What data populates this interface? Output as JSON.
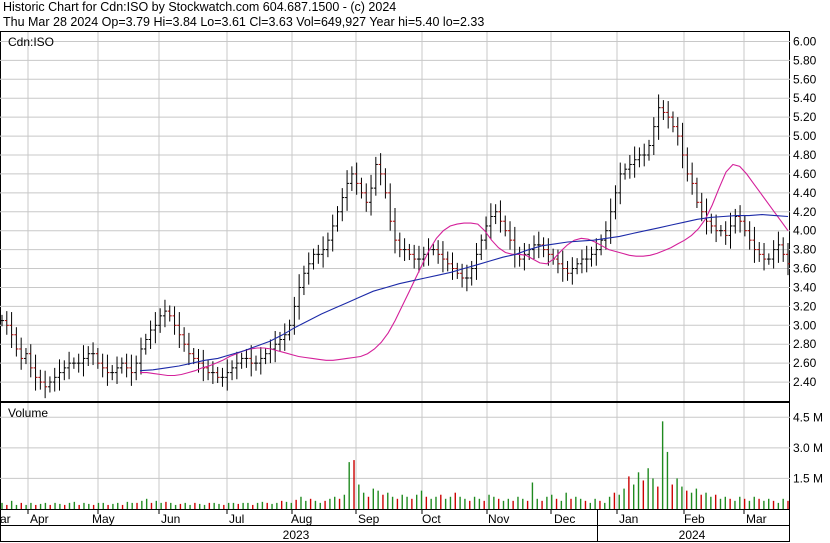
{
  "header": {
    "line1": "Historic Chart for Cdn:ISO by Stockwatch.com 604.687.1500 - (c) 2024",
    "line2": "Thu Mar 28 2024  Op=3.79  Hi=3.84  Lo=3.61  Cl=3.63  Vol=649,927  Year hi=5.40  lo=2.33"
  },
  "chart_data": [
    {
      "type": "ohlc",
      "title": "Cdn:ISO",
      "ylim": [
        2.2,
        6.1
      ],
      "yticks": [
        "2.40",
        "2.60",
        "2.80",
        "3.00",
        "3.20",
        "3.40",
        "3.60",
        "3.80",
        "4.00",
        "4.20",
        "4.40",
        "4.60",
        "4.80",
        "5.00",
        "5.20",
        "5.40",
        "5.60",
        "5.80",
        "6.00"
      ],
      "x_month_labels": [
        "ar",
        "Apr",
        "May",
        "Jun",
        "Jul",
        "Aug",
        "Sep",
        "Oct",
        "Nov",
        "Dec",
        "Jan",
        "Feb",
        "Mar"
      ],
      "x_year_labels": [
        "2023",
        "2024"
      ],
      "series": [
        {
          "name": "",
          "kind": "close",
          "values": [
            3.05,
            3.0,
            2.9,
            2.75,
            2.65,
            2.7,
            2.55,
            2.45,
            2.4,
            2.35,
            2.4,
            2.45,
            2.5,
            2.55,
            2.6,
            2.6,
            2.6,
            2.65,
            2.7,
            2.7,
            2.6,
            2.55,
            2.5,
            2.5,
            2.55,
            2.6,
            2.55,
            2.5,
            2.6,
            2.75,
            2.85,
            2.95,
            3.0,
            3.1,
            3.15,
            3.1,
            3.0,
            2.9,
            2.8,
            2.7,
            2.65,
            2.6,
            2.55,
            2.5,
            2.5,
            2.45,
            2.45,
            2.5,
            2.55,
            2.6,
            2.65,
            2.65,
            2.6,
            2.6,
            2.65,
            2.7,
            2.75,
            2.8,
            2.85,
            2.9,
            3.0,
            3.2,
            3.4,
            3.55,
            3.65,
            3.75,
            3.75,
            3.8,
            3.9,
            4.05,
            4.2,
            4.35,
            4.5,
            4.6,
            4.5,
            4.4,
            4.3,
            4.45,
            4.7,
            4.6,
            4.4,
            4.1,
            3.9,
            3.8,
            3.8,
            3.75,
            3.7,
            3.7,
            3.75,
            3.8,
            3.8,
            3.75,
            3.7,
            3.65,
            3.6,
            3.55,
            3.5,
            3.5,
            3.6,
            3.75,
            3.9,
            4.05,
            4.15,
            4.2,
            4.1,
            4.0,
            3.9,
            3.75,
            3.7,
            3.75,
            3.8,
            3.85,
            3.85,
            3.8,
            3.75,
            3.7,
            3.65,
            3.6,
            3.55,
            3.6,
            3.65,
            3.7,
            3.7,
            3.75,
            3.8,
            3.9,
            4.0,
            4.2,
            4.4,
            4.6,
            4.65,
            4.7,
            4.75,
            4.8,
            4.8,
            4.9,
            5.1,
            5.3,
            5.25,
            5.2,
            5.1,
            5.0,
            4.8,
            4.6,
            4.5,
            4.3,
            4.2,
            4.1,
            4.05,
            4.0,
            4.0,
            3.95,
            4.05,
            4.15,
            4.1,
            4.0,
            3.9,
            3.8,
            3.75,
            3.7,
            3.7,
            3.8,
            3.85,
            3.75,
            3.65
          ]
        },
        {
          "name": "",
          "kind": "ma-short",
          "color": "#d4209a",
          "values": [
            2.5,
            2.5,
            2.49,
            2.48,
            2.47,
            2.47,
            2.48,
            2.5,
            2.52,
            2.55,
            2.57,
            2.6,
            2.63,
            2.67,
            2.7,
            2.73,
            2.75,
            2.76,
            2.76,
            2.75,
            2.73,
            2.71,
            2.69,
            2.67,
            2.66,
            2.65,
            2.64,
            2.63,
            2.63,
            2.64,
            2.65,
            2.66,
            2.67,
            2.7,
            2.75,
            2.82,
            2.92,
            3.05,
            3.2,
            3.35,
            3.5,
            3.65,
            3.8,
            3.92,
            4.0,
            4.05,
            4.07,
            4.08,
            4.08,
            4.07,
            4.0,
            3.9,
            3.82,
            3.77,
            3.75,
            3.75,
            3.74,
            3.7,
            3.66,
            3.65,
            3.7,
            3.78,
            3.85,
            3.9,
            3.92,
            3.91,
            3.88,
            3.84,
            3.8,
            3.78,
            3.76,
            3.74,
            3.73,
            3.73,
            3.74,
            3.76,
            3.79,
            3.82,
            3.86,
            3.9,
            3.95,
            4.02,
            4.12,
            4.27,
            4.45,
            4.62,
            4.7,
            4.68,
            4.6,
            4.5,
            4.4,
            4.3,
            4.2,
            4.1,
            4.0
          ]
        },
        {
          "name": "",
          "kind": "ma-long",
          "color": "#1c2aa8",
          "values": [
            2.52,
            2.53,
            2.55,
            2.57,
            2.6,
            2.63,
            2.65,
            2.69,
            2.73,
            2.78,
            2.83,
            2.9,
            2.98,
            3.05,
            3.12,
            3.18,
            3.24,
            3.3,
            3.36,
            3.4,
            3.44,
            3.47,
            3.5,
            3.53,
            3.56,
            3.6,
            3.64,
            3.68,
            3.72,
            3.75,
            3.8,
            3.84,
            3.86,
            3.88,
            3.89,
            3.9,
            3.92,
            3.94,
            3.97,
            4.0,
            4.03,
            4.06,
            4.09,
            4.12,
            4.14,
            4.15,
            4.16,
            4.16,
            4.17,
            4.16,
            4.15
          ]
        }
      ]
    },
    {
      "type": "bar",
      "title": "Volume",
      "ylim": [
        0,
        5.2
      ],
      "yticks": [
        "1.5 M",
        "3.0 M",
        "4.5 M"
      ],
      "unit": "M",
      "values": [
        0.3,
        0.2,
        0.4,
        0.2,
        0.3,
        0.2,
        0.3,
        0.2,
        0.25,
        0.3,
        0.2,
        0.3,
        0.25,
        0.2,
        0.3,
        0.35,
        0.2,
        0.3,
        0.25,
        0.2,
        0.3,
        0.3,
        0.2,
        0.25,
        0.3,
        0.2,
        0.35,
        0.3,
        0.3,
        0.4,
        0.5,
        0.3,
        0.4,
        0.3,
        0.35,
        0.3,
        0.2,
        0.25,
        0.3,
        0.2,
        0.3,
        0.25,
        0.2,
        0.3,
        0.3,
        0.25,
        0.2,
        0.3,
        0.3,
        0.25,
        0.3,
        0.3,
        0.2,
        0.3,
        0.35,
        0.3,
        0.25,
        0.3,
        0.4,
        0.35,
        0.3,
        0.45,
        0.6,
        0.4,
        0.5,
        0.4,
        0.3,
        0.4,
        0.5,
        0.6,
        0.5,
        0.7,
        2.3,
        2.4,
        1.2,
        0.8,
        0.6,
        1.0,
        0.9,
        0.7,
        0.8,
        0.6,
        0.5,
        0.7,
        0.6,
        0.5,
        0.7,
        0.9,
        0.6,
        0.5,
        0.6,
        0.7,
        0.5,
        0.6,
        0.8,
        0.6,
        0.5,
        0.4,
        0.6,
        0.5,
        0.4,
        0.7,
        0.6,
        0.5,
        0.4,
        0.5,
        0.4,
        0.6,
        0.5,
        0.4,
        1.3,
        0.5,
        0.4,
        0.6,
        0.7,
        0.5,
        0.4,
        0.8,
        0.5,
        0.6,
        0.5,
        0.4,
        0.3,
        0.5,
        0.4,
        0.3,
        0.6,
        0.8,
        0.7,
        1.0,
        1.6,
        1.2,
        1.8,
        1.4,
        2.0,
        1.5,
        1.1,
        4.3,
        2.8,
        1.2,
        1.5,
        1.1,
        0.9,
        0.8,
        1.0,
        0.7,
        0.8,
        0.6,
        0.7,
        0.5,
        0.6,
        0.5,
        0.4,
        0.6,
        0.5,
        0.4,
        0.6,
        0.5,
        0.4,
        0.5,
        0.4,
        0.3,
        0.5,
        0.4
      ]
    }
  ]
}
